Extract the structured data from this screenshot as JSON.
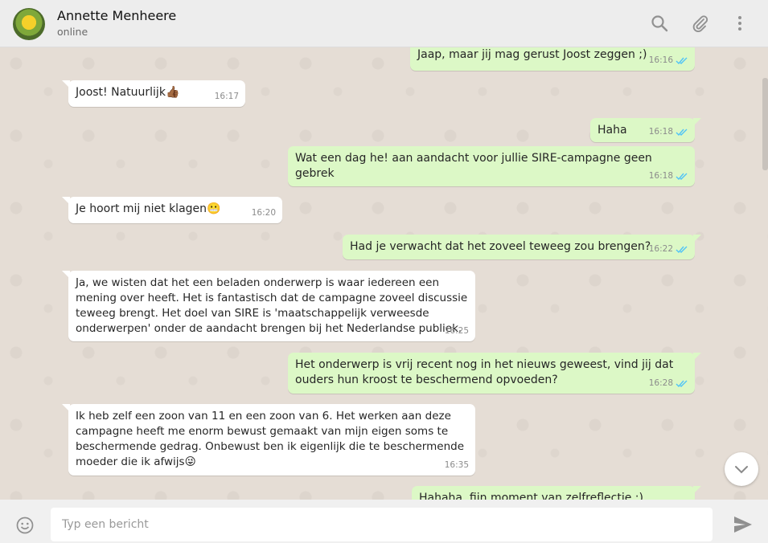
{
  "header": {
    "contact_name": "Annette Menheere",
    "status": "online",
    "actions": [
      "search-icon",
      "attach-icon",
      "menu-icon"
    ]
  },
  "messages": [
    {
      "dir": "out",
      "text": "Jaap, maar jij mag gerust Joost zeggen ;)",
      "time": "16:16",
      "read": true
    },
    {
      "dir": "in",
      "text": "Joost! Natuurlijk",
      "emoji": "👍🏾",
      "time": "16:17"
    },
    {
      "dir": "out",
      "text": "Haha",
      "time": "16:18",
      "read": true
    },
    {
      "dir": "out",
      "text": "Wat een dag he! aan aandacht voor jullie SIRE-campagne geen gebrek",
      "time": "16:18",
      "read": true
    },
    {
      "dir": "in",
      "text": "Je hoort mij niet klagen",
      "emoji": "😬",
      "time": "16:20"
    },
    {
      "dir": "out",
      "text": "Had je verwacht dat het zoveel teweeg zou brengen?",
      "time": "16:22",
      "read": true
    },
    {
      "dir": "in",
      "text": "Ja, we wisten dat het een beladen onderwerp is waar iedereen een mening over heeft. Het is fantastisch dat de campagne zoveel discussie teweeg brengt. Het doel van SIRE is  'maatschappelijk verweesde onderwerpen' onder de aandacht brengen bij het Nederlandse publiek.",
      "time": "16:25"
    },
    {
      "dir": "out",
      "text": "Het onderwerp is vrij recent nog in het nieuws geweest, vind jij dat ouders hun kroost te beschermend opvoeden?",
      "time": "16:28",
      "read": true
    },
    {
      "dir": "in",
      "text": "Ik heb zelf een zoon van 11 en een zoon van 6. Het werken aan deze campagne heeft me enorm bewust gemaakt van mijn eigen soms te beschermende gedrag. Onbewust ben ik eigenlijk die te beschermende moeder die ik afwijs",
      "emoji": "😜",
      "time": "16:35"
    },
    {
      "dir": "out",
      "text": "Hahaha, fijn moment van zelfreflectie :)",
      "time": "",
      "read": false
    }
  ],
  "composer": {
    "placeholder": "Typ een bericht",
    "value": ""
  },
  "colors": {
    "incoming": "#ffffff",
    "outgoing": "#dcf8c6",
    "read_tick": "#4fc3f7",
    "background": "#e5ddd5"
  }
}
